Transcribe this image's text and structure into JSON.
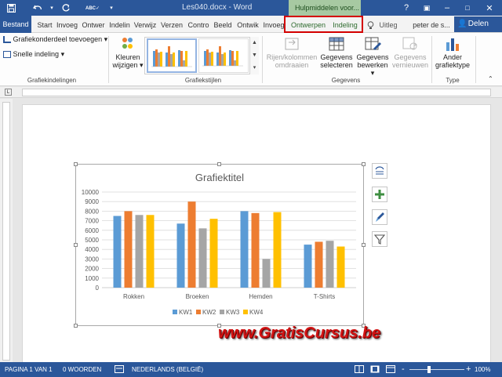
{
  "window": {
    "doc_title": "Les040.docx - Word",
    "tools_context": "Hulpmiddelen voor...",
    "user": "peter de s...",
    "share": "Delen"
  },
  "tabs": [
    {
      "label": "Start"
    },
    {
      "label": "Invoeg"
    },
    {
      "label": "Ontwer"
    },
    {
      "label": "Indelin"
    },
    {
      "label": "Verwijz"
    },
    {
      "label": "Verzen"
    },
    {
      "label": "Contro"
    },
    {
      "label": "Beeld"
    },
    {
      "label": "Ontwik"
    },
    {
      "label": "Invoeg"
    },
    {
      "label": "Ontwerpen"
    },
    {
      "label": "Indeling"
    }
  ],
  "file_tab": "Bestand",
  "tell_me": "Uitleg",
  "ribbon": {
    "add_element": "Grafiekonderdeel toevoegen",
    "quick_layout": "Snelle indeling",
    "layouts_group": "Grafiekindelingen",
    "colors_line1": "Kleuren",
    "colors_line2": "wijzigen",
    "styles_group": "Grafiekstijlen",
    "switch_line1": "Rijen/kolommen",
    "switch_line2": "omdraaien",
    "select_line1": "Gegevens",
    "select_line2": "selecteren",
    "edit_line1": "Gegevens",
    "edit_line2": "bewerken",
    "refresh_line1": "Gegevens",
    "refresh_line2": "vernieuwen",
    "data_group": "Gegevens",
    "type_line1": "Ander",
    "type_line2": "grafiektype",
    "type_group": "Type"
  },
  "colors": {
    "word_blue": "#2b579a",
    "highlight_red": "#d40000",
    "kw1": "#5b9bd5",
    "kw2": "#ed7d31",
    "kw3": "#a5a5a5",
    "kw4": "#ffc000"
  },
  "chart_data": {
    "type": "bar",
    "title": "Grafiektitel",
    "categories": [
      "Rokken",
      "Broeken",
      "Hemden",
      "T-Shirts"
    ],
    "series": [
      {
        "name": "KW1",
        "values": [
          7500,
          6700,
          8000,
          4500
        ]
      },
      {
        "name": "KW2",
        "values": [
          8000,
          9000,
          7800,
          4800
        ]
      },
      {
        "name": "KW3",
        "values": [
          7600,
          6200,
          3000,
          4900
        ]
      },
      {
        "name": "KW4",
        "values": [
          7600,
          7200,
          7900,
          4300
        ]
      }
    ],
    "yticks": [
      "0",
      "1000",
      "2000",
      "3000",
      "4000",
      "5000",
      "6000",
      "7000",
      "8000",
      "9000",
      "10000"
    ],
    "ylim": [
      0,
      10000
    ],
    "grid": true,
    "legend": "bottom"
  },
  "watermark": "www.GratisCursus.be",
  "status": {
    "page": "PAGINA 1 VAN 1",
    "words": "0 WOORDEN",
    "language": "NEDERLANDS (BELGIË)",
    "zoom": "100%",
    "zoom_minus": "-",
    "zoom_plus": "+"
  },
  "icons": {
    "save": "save-icon",
    "undo": "undo-icon",
    "redo": "redo-icon",
    "spelling": "spelling-icon"
  }
}
